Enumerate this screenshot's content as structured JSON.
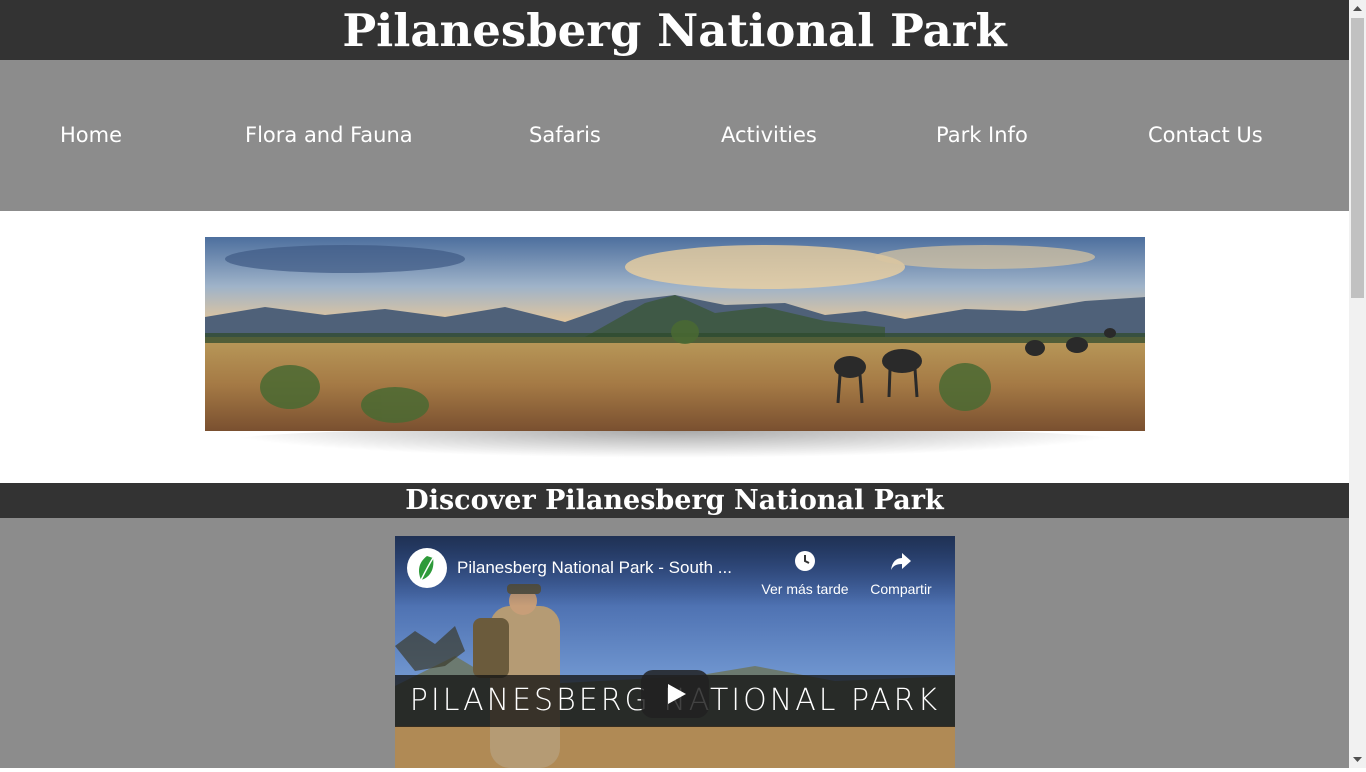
{
  "header": {
    "title": "Pilanesberg National Park"
  },
  "nav": {
    "items": [
      {
        "label": "Home"
      },
      {
        "label": "Flora and Fauna"
      },
      {
        "label": "Safaris"
      },
      {
        "label": "Activities"
      },
      {
        "label": "Park Info"
      },
      {
        "label": "Contact Us"
      }
    ]
  },
  "section": {
    "heading": "Discover Pilanesberg National Park"
  },
  "video": {
    "title": "Pilanesberg National Park - South ...",
    "watch_later": "Ver más tarde",
    "share": "Compartir",
    "overlay_text": "PILANESBERG NATIONAL PARK",
    "icons": [
      "channel-logo-icon",
      "clock-icon",
      "share-icon",
      "play-icon"
    ]
  },
  "colors": {
    "header_bg": "#333333",
    "nav_bg": "#8c8c8c",
    "text": "#ffffff"
  }
}
